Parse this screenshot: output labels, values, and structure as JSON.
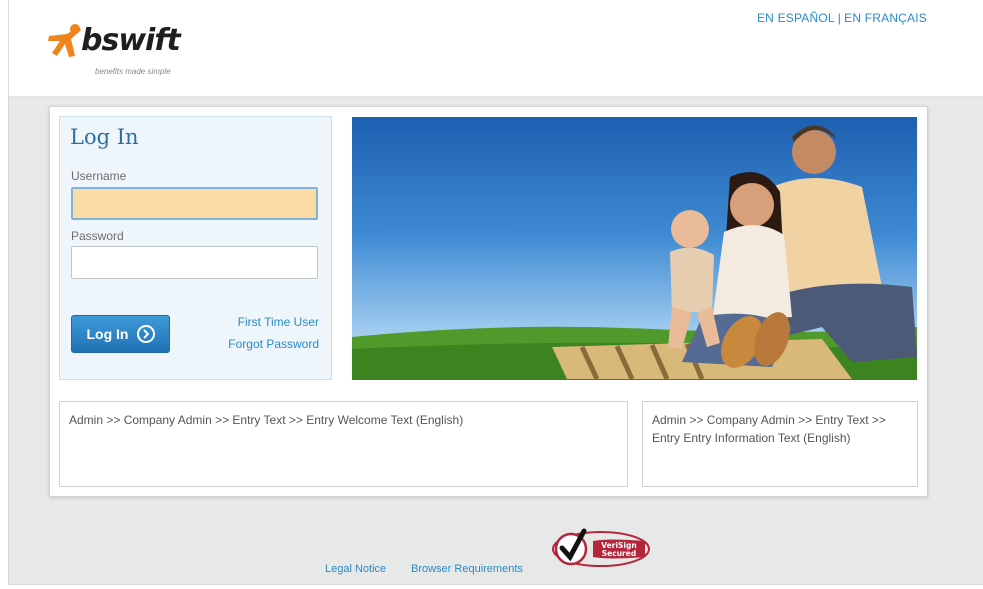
{
  "header": {
    "logo": {
      "name": "bswift",
      "tagline": "benefits made simple",
      "mark_color": "#f0841c"
    },
    "languages": [
      {
        "label": "EN ESPAÑOL"
      },
      {
        "label": "EN FRANÇAIS"
      }
    ],
    "language_separator": "|"
  },
  "login": {
    "title": "Log In",
    "username_label": "Username",
    "username_value": "",
    "password_label": "Password",
    "password_value": "",
    "submit_label": "Log In",
    "first_time_user": "First Time User",
    "forgot_password": "Forgot Password"
  },
  "content": {
    "welcome_text": "Admin >> Company Admin >> Entry Text >> Entry Welcome Text (English)",
    "information_text": "Admin >> Company Admin >> Entry Text >> Entry Entry Information Text (English)"
  },
  "footer": {
    "legal_notice": "Legal Notice",
    "browser_requirements": "Browser Requirements",
    "verisign": {
      "line1": "VeriSign",
      "line2": "Secured"
    }
  },
  "colors": {
    "accent": "#2b8ac6",
    "button": "#1f72b3",
    "focus_field": "#fbdca5",
    "login_panel_bg": "#eef6fc",
    "verisign_red": "#b3263b"
  },
  "icons": {
    "submit": "chevron-right-circle-icon",
    "security": "checkmark-icon"
  }
}
